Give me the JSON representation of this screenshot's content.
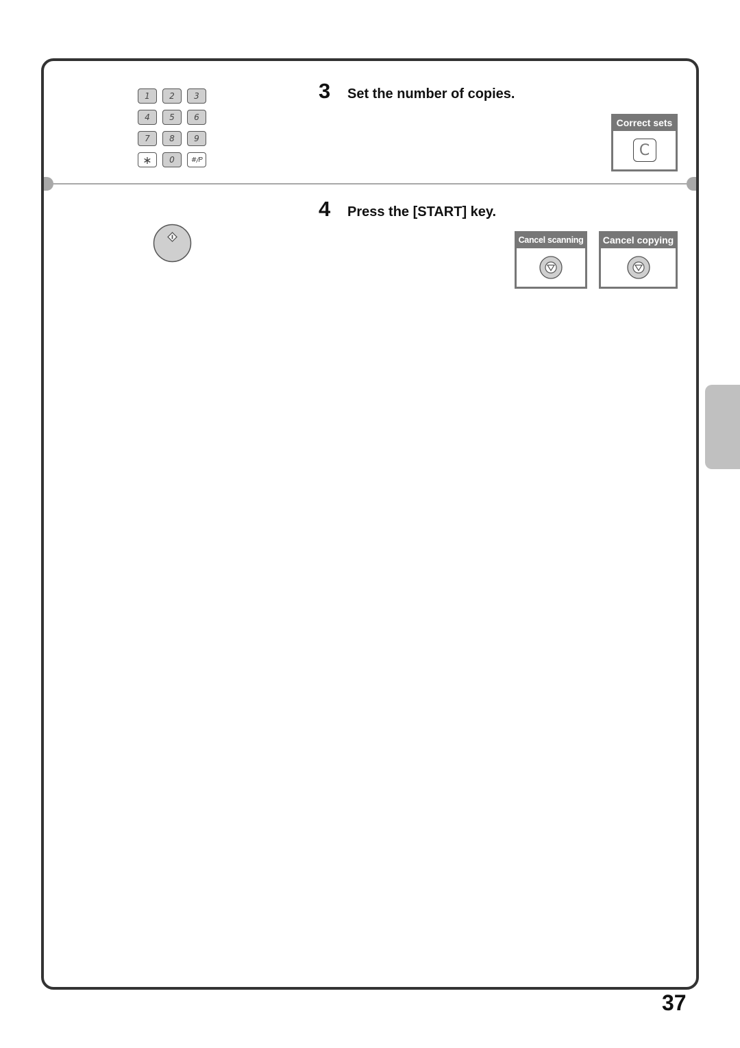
{
  "keypad": {
    "keys": [
      "1",
      "2",
      "3",
      "4",
      "5",
      "6",
      "7",
      "8",
      "9",
      "∗",
      "0",
      "#/P"
    ]
  },
  "steps": [
    {
      "number": "3",
      "text": "Set the number of copies."
    },
    {
      "number": "4",
      "text": "Press the [START] key."
    }
  ],
  "panels": {
    "correct_sets": {
      "label": "Correct sets",
      "key": "C"
    },
    "cancel_scanning": {
      "label": "Cancel scanning",
      "icon": "stop-icon"
    },
    "cancel_copying": {
      "label": "Cancel copying",
      "icon": "stop-icon"
    }
  },
  "start_key": {
    "icon": "start-icon"
  },
  "colors": {
    "frame": "#333333",
    "panel_header": "#777777",
    "key_fill": "#cfcfcf",
    "side_tab": "#c0c0c0"
  },
  "page_number": "37"
}
